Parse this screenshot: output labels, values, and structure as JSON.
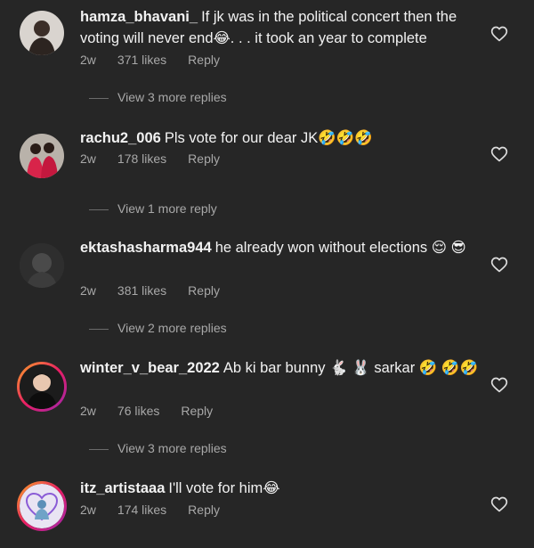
{
  "comments": [
    {
      "username": "hamza_bhavani_",
      "text": "If jk was in the political concert then the voting will never end😂. . . it took an year to complete",
      "time": "2w",
      "likes": "371 likes",
      "reply": "Reply",
      "view_more": "View 3 more replies"
    },
    {
      "username": "rachu2_006",
      "text": "Pls vote for our dear JK🤣🤣🤣",
      "time": "2w",
      "likes": "178 likes",
      "reply": "Reply",
      "view_more": "View 1 more reply"
    },
    {
      "username": "ektashasharma944",
      "text": "he already won without elections 😌 😎",
      "time": "2w",
      "likes": "381 likes",
      "reply": "Reply",
      "view_more": "View 2 more replies"
    },
    {
      "username": "winter_v_bear_2022",
      "text": "Ab ki bar bunny 🐇 🐰 sarkar 🤣 🤣🤣",
      "time": "2w",
      "likes": "76 likes",
      "reply": "Reply",
      "view_more": "View 3 more replies"
    },
    {
      "username": "itz_artistaaa",
      "text": "I'll vote for him😂",
      "time": "2w",
      "likes": "174 likes",
      "reply": "Reply"
    }
  ],
  "colors": {
    "background": "#262626",
    "text": "#f2f2f2",
    "muted": "#a8a8a8"
  }
}
